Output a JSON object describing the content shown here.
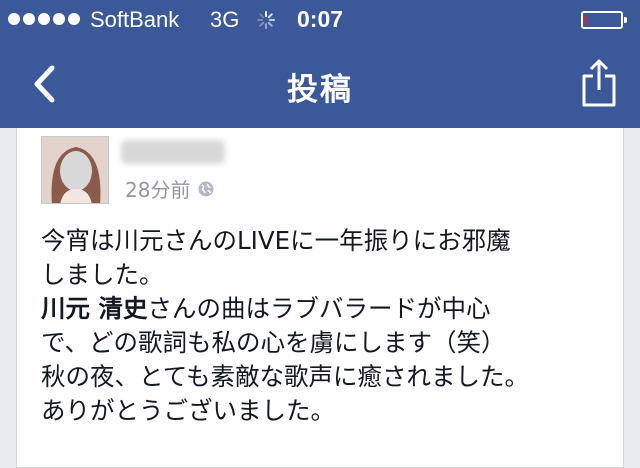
{
  "status_bar": {
    "signal_bars": 5,
    "carrier": "SoftBank",
    "network": "3G",
    "time": "0:07",
    "battery_level_percent": 5,
    "battery_color": "#e02020",
    "icons": [
      "signal-dots",
      "activity-spinner-icon",
      "battery-icon"
    ]
  },
  "nav_bar": {
    "title": "投稿",
    "back_icon": "chevron-left-icon",
    "share_icon": "share-icon",
    "bg_color": "#3b5998"
  },
  "post": {
    "timestamp": "28分前",
    "privacy_icon": "globe-icon",
    "lines": {
      "line1": "今宵は川元さんのLIVEに一年振りにお邪魔",
      "line2": "しました。",
      "line3_mention": "川元 清史",
      "line3_rest": "さんの曲はラブバラードが中心",
      "line4": "で、どの歌詞も私の心を虜にします（笑）",
      "line5": "秋の夜、とても素敵な歌声に癒されました。",
      "line6": "ありがとうございました。"
    }
  }
}
